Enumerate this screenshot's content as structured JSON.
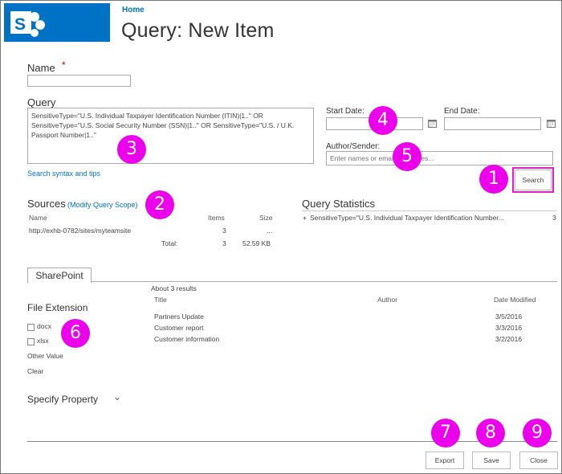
{
  "colors": {
    "brand": "#0072c6",
    "callout": "#ec00ec",
    "link": "#0072c6"
  },
  "header": {
    "home": "Home",
    "title": "Query: New Item"
  },
  "name_field": {
    "label": "Name",
    "required_mark": "*",
    "value": ""
  },
  "query": {
    "label": "Query",
    "text": "SensitiveType=\"U.S. Individual Taxpayer Identification Number (ITIN)|1..\" OR SensitiveType=\"U.S. Social Security Number (SSN)|1..\" OR SensitiveType=\"U.S. / U.K. Passport Number|1..\"",
    "help_link": "Search syntax and tips"
  },
  "dates": {
    "start_label": "Start Date:",
    "end_label": "End Date:",
    "start_value": "",
    "end_value": ""
  },
  "author": {
    "label": "Author/Sender:",
    "placeholder": "Enter names or email addresses..."
  },
  "search_button": "Search",
  "sources": {
    "title": "Sources",
    "modify_link": "(Modify Query Scope)",
    "columns": [
      "Name",
      "Items",
      "Size"
    ],
    "rows": [
      {
        "name": "http://exhb-0782/sites/myteamsite",
        "items": "3",
        "size": "..."
      }
    ],
    "total_label": "Total:",
    "total_items": "3",
    "total_size": "52.59 KB"
  },
  "stats": {
    "title": "Query Statistics",
    "expand": "+",
    "row_text": "SensitiveType=\"U.S. Individual Taxpayer Identification Number...",
    "row_count": "3"
  },
  "tab": {
    "label": "SharePoint"
  },
  "results": {
    "summary": "About 3 results",
    "columns": [
      "Title",
      "Author",
      "Date Modified"
    ],
    "rows": [
      {
        "title": "Partners Update",
        "author": "",
        "date": "3/5/2016"
      },
      {
        "title": "Customer report",
        "author": "",
        "date": "3/3/2016"
      },
      {
        "title": "Customer information",
        "author": "",
        "date": "3/2/2016"
      }
    ]
  },
  "refiner": {
    "title": "File Extension",
    "options": [
      "docx",
      "xlsx"
    ],
    "other": "Other Value",
    "clear": "Clear",
    "specify": "Specify Property",
    "specify_chevron": "⌄"
  },
  "footer": {
    "export": "Export",
    "save": "Save",
    "close": "Close"
  },
  "callouts": [
    "1",
    "2",
    "3",
    "4",
    "5",
    "6",
    "7",
    "8",
    "9"
  ]
}
